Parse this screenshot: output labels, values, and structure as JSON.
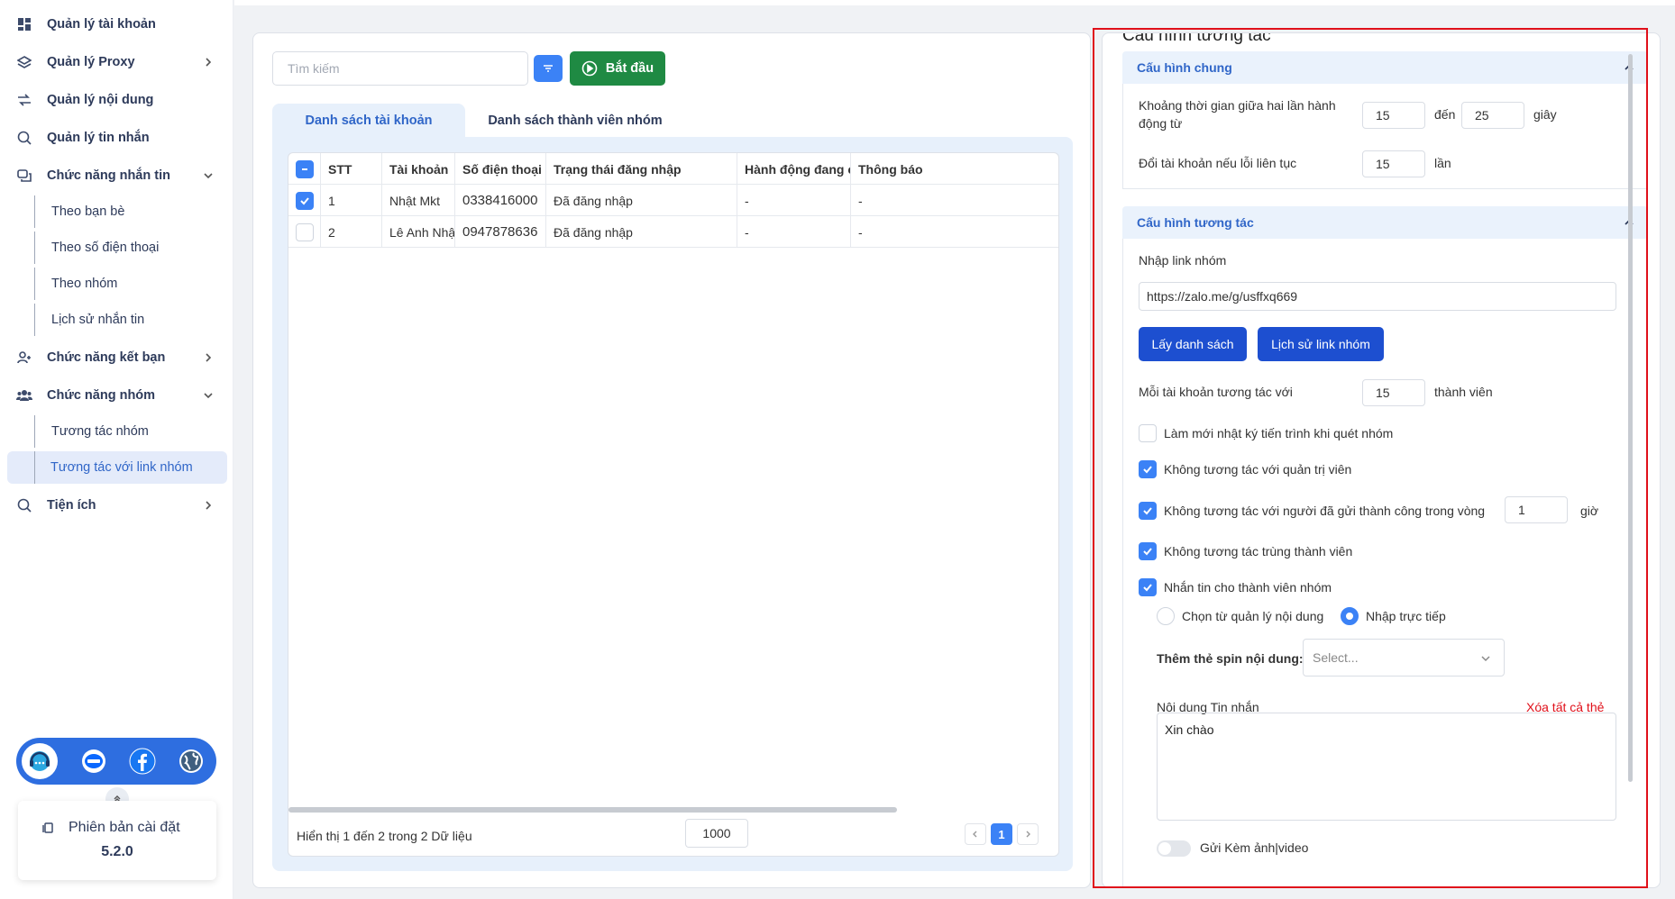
{
  "sidebar": {
    "items": [
      {
        "label": "Quản lý tài khoản"
      },
      {
        "label": "Quản lý Proxy"
      },
      {
        "label": "Quản lý nội dung"
      },
      {
        "label": "Quản lý tin nhắn"
      },
      {
        "label": "Chức năng nhắn tin"
      },
      {
        "label": "Chức năng kết bạn"
      },
      {
        "label": "Chức năng nhóm"
      },
      {
        "label": "Tiện ích"
      }
    ],
    "messaging_sub": [
      "Theo bạn bè",
      "Theo số điện thoại",
      "Theo nhóm",
      "Lịch sử nhắn tin"
    ],
    "group_sub": [
      "Tương tác nhóm",
      "Tương tác với link nhóm"
    ],
    "social": [
      "support-icon",
      "zalo-icon",
      "facebook-icon",
      "globe-icon"
    ],
    "version_label": "Phiên bản cài đặt",
    "version_number": "5.2.0"
  },
  "toolbar": {
    "search_placeholder": "Tìm kiếm",
    "start_label": "Bắt đầu"
  },
  "tabs": [
    "Danh sách tài khoản",
    "Danh sách thành viên nhóm"
  ],
  "table": {
    "columns": [
      "STT",
      "Tài khoản",
      "Số điện thoại",
      "Trạng thái đăng nhập",
      "Hành động đang c...",
      "Thông báo"
    ],
    "rows": [
      {
        "checked": true,
        "stt": "1",
        "account": "Nhật Mkt",
        "phone": "0338416000",
        "status": "Đã đăng nhập",
        "action": "-",
        "notice": "-"
      },
      {
        "checked": false,
        "stt": "2",
        "account": "Lê Anh Nhật",
        "phone": "0947878636",
        "status": "Đã đăng nhập",
        "action": "-",
        "notice": "-"
      }
    ],
    "footer_text": "Hiển thị 1 đến 2 trong 2 Dữ liệu",
    "page_size": "1000",
    "current_page": "1"
  },
  "config": {
    "title": "Cấu hình tương tác",
    "general": {
      "header": "Cấu hình chung",
      "interval_label": "Khoảng thời gian giữa hai lần hành động từ",
      "interval_from": "15",
      "interval_to_label": "đến",
      "interval_to": "25",
      "interval_unit": "giây",
      "switch_label": "Đổi tài khoản nếu lỗi liên tục",
      "switch_value": "15",
      "switch_unit": "lần"
    },
    "interaction": {
      "header": "Cấu hình tương tác",
      "link_label": "Nhập link nhóm",
      "link_value": "https://zalo.me/g/usffxq669",
      "get_list_btn": "Lấy danh sách",
      "history_btn": "Lịch sử link nhóm",
      "per_account_label": "Mỗi tài khoản tương tác với",
      "per_account_value": "15",
      "per_account_unit": "thành viên",
      "opt_refresh": "Làm mới nhật ký tiến trình khi quét nhóm",
      "opt_skip_admin": "Không tương tác với quản trị viên",
      "opt_skip_sent": "Không tương tác với người đã gửi thành công trong vòng",
      "skip_sent_value": "1",
      "skip_sent_unit": "giờ",
      "opt_skip_dup": "Không tương tác trùng thành viên",
      "opt_message": "Nhắn tin cho thành viên nhóm",
      "radio_content_mgr": "Chọn từ quản lý nội dung",
      "radio_direct": "Nhập trực tiếp",
      "spin_label": "Thêm thẻ spin nội dung:",
      "spin_placeholder": "Select...",
      "message_label": "Nội dung Tin nhắn",
      "clear_tags": "Xóa tất cả thẻ",
      "message_value": "Xin chào",
      "attach_label": "Gửi Kèm ảnh|video"
    }
  },
  "colors": {
    "accent": "#3b82f6",
    "start_green": "#1f8a43",
    "button_blue": "#1d4fd0",
    "highlight_red": "#e0101a"
  }
}
